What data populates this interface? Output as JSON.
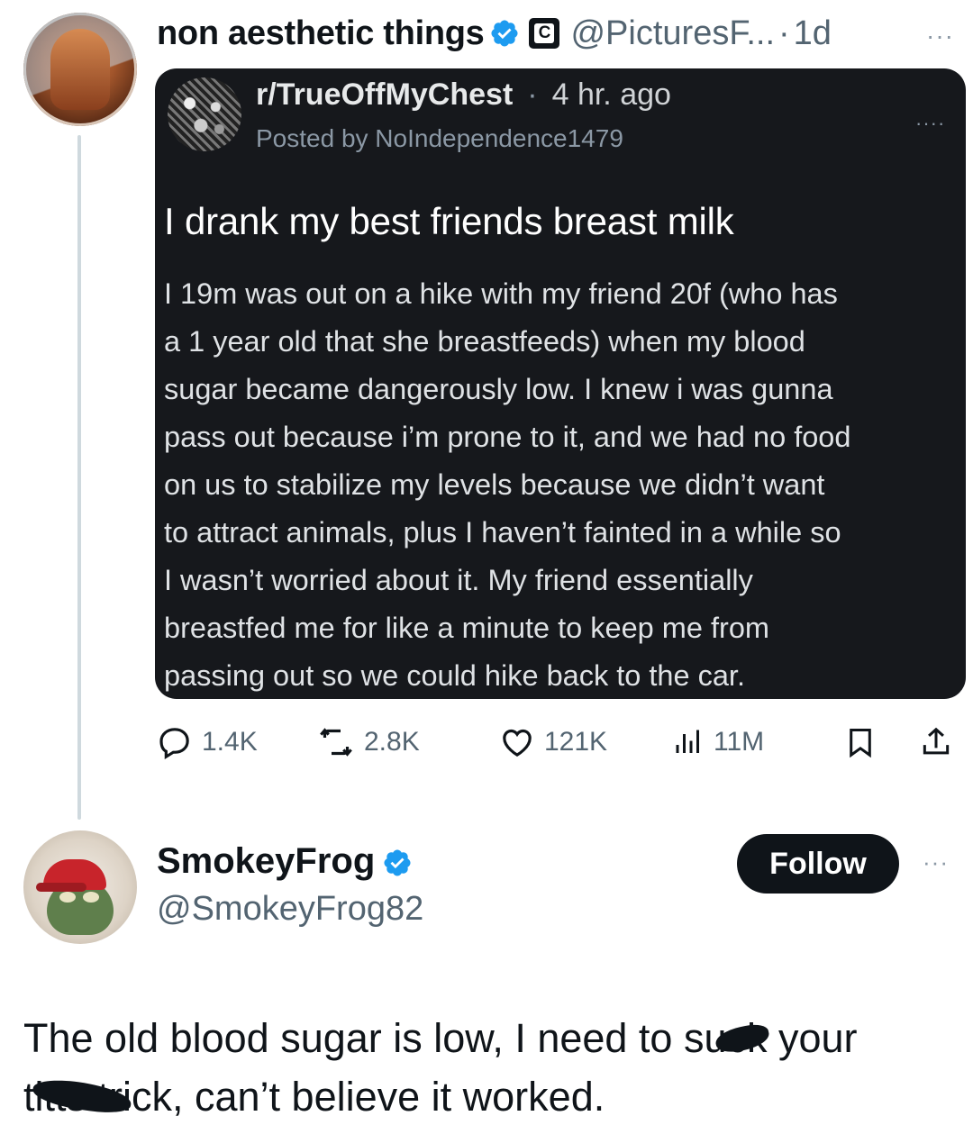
{
  "tweet": {
    "author_name": "non aesthetic things",
    "handle": "@PicturesF...",
    "separator": "·",
    "time": "1d",
    "more_label": "···",
    "embedded_post": {
      "subreddit": "r/TrueOffMyChest",
      "separator": "·",
      "age": "4 hr. ago",
      "posted_by": "Posted by NoIndependence1479",
      "more_label": "····",
      "title": "I drank my best friends breast milk",
      "body_lines": [
        "I 19m was out on a hike with my friend 20f (who has",
        "a 1 year old that she breastfeeds) when my blood",
        "sugar became dangerously low. I knew i was gunna",
        "pass out because i’m prone to it, and we had no food",
        "on us to stabilize my levels because we didn’t want",
        "to attract animals, plus I haven’t fainted in a while so",
        "I wasn’t worried about it. My friend essentially",
        "breastfed me for like a minute to keep me from",
        "passing out so we could hike back to the car."
      ]
    },
    "actions": {
      "replies": "1.4K",
      "retweets": "2.8K",
      "likes": "121K",
      "views": "11M"
    }
  },
  "reply": {
    "author_name": "SmokeyFrog",
    "handle": "@SmokeyFrog82",
    "follow_label": "Follow",
    "more_label": "···",
    "text_lines": [
      "The old blood sugar is low, I need to suck your",
      "titts trick, can’t believe it worked."
    ]
  },
  "colors": {
    "verified": "#1d9bf0",
    "card_background": "#16181c",
    "muted_text": "#536471",
    "follow_button": "#0f1419"
  },
  "icons": [
    "verified-icon",
    "company-badge-icon",
    "reply-icon",
    "retweet-icon",
    "like-icon",
    "views-icon",
    "bookmark-icon",
    "share-icon"
  ]
}
